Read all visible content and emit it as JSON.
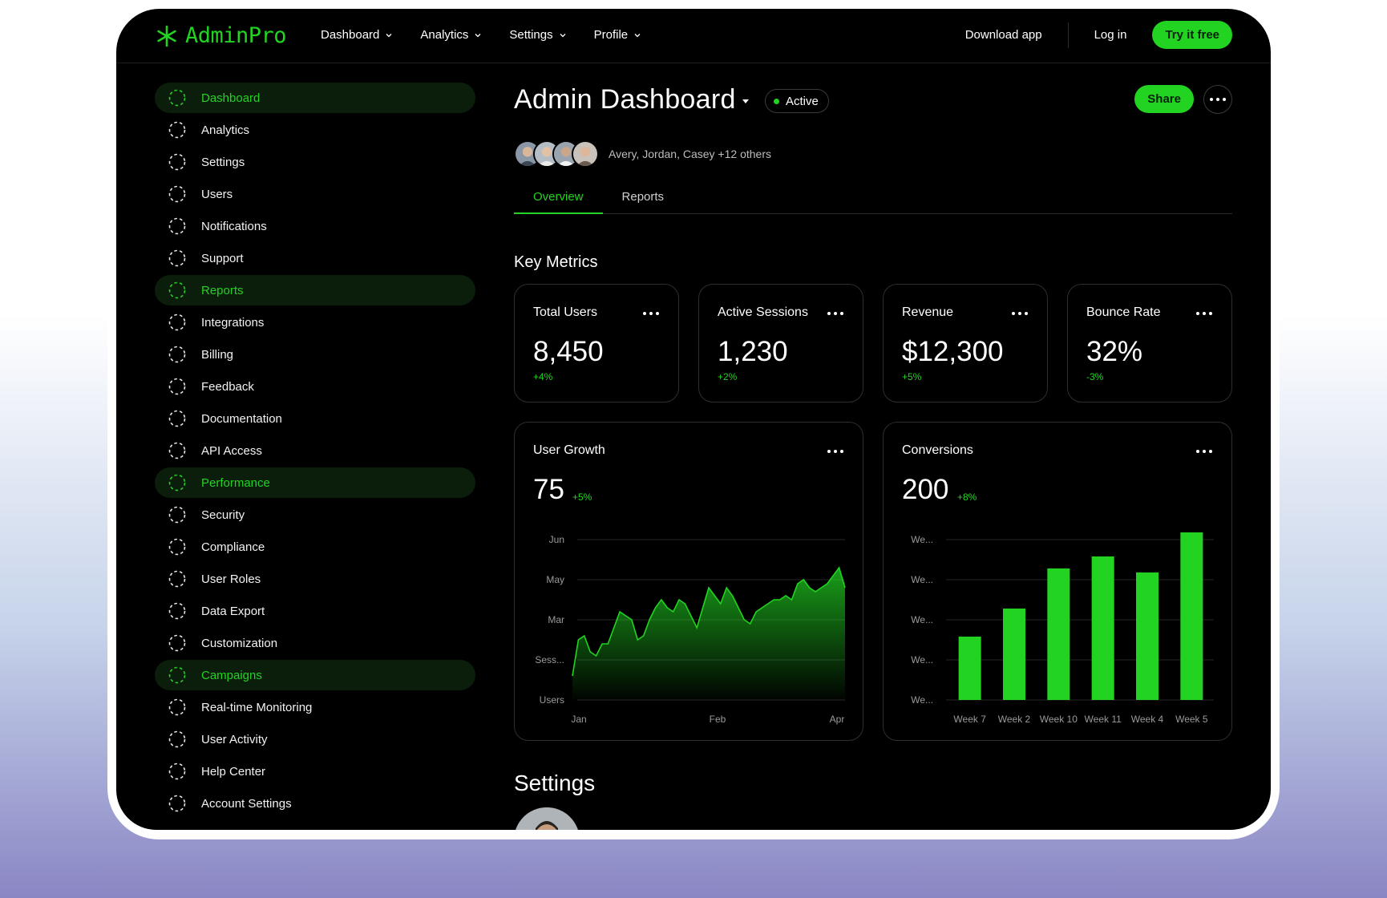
{
  "brand": {
    "name": "AdminPro",
    "color": "#22d322",
    "icon": "asterisk-icon"
  },
  "nav": {
    "menu": [
      {
        "label": "Dashboard"
      },
      {
        "label": "Analytics"
      },
      {
        "label": "Settings"
      },
      {
        "label": "Profile"
      }
    ],
    "download": "Download app",
    "login": "Log in",
    "try": "Try it free"
  },
  "sidebar": {
    "items": [
      {
        "label": "Dashboard",
        "active": true
      },
      {
        "label": "Analytics",
        "active": false
      },
      {
        "label": "Settings",
        "active": false
      },
      {
        "label": "Users",
        "active": false
      },
      {
        "label": "Notifications",
        "active": false
      },
      {
        "label": "Support",
        "active": false
      },
      {
        "label": "Reports",
        "active": true
      },
      {
        "label": "Integrations",
        "active": false
      },
      {
        "label": "Billing",
        "active": false
      },
      {
        "label": "Feedback",
        "active": false
      },
      {
        "label": "Documentation",
        "active": false
      },
      {
        "label": "API Access",
        "active": false
      },
      {
        "label": "Performance",
        "active": true
      },
      {
        "label": "Security",
        "active": false
      },
      {
        "label": "Compliance",
        "active": false
      },
      {
        "label": "User Roles",
        "active": false
      },
      {
        "label": "Data Export",
        "active": false
      },
      {
        "label": "Customization",
        "active": false
      },
      {
        "label": "Campaigns",
        "active": true
      },
      {
        "label": "Real-time Monitoring",
        "active": false
      },
      {
        "label": "User Activity",
        "active": false
      },
      {
        "label": "Help Center",
        "active": false
      },
      {
        "label": "Account Settings",
        "active": false
      }
    ]
  },
  "page": {
    "title": "Admin Dashboard",
    "status": "Active",
    "share": "Share",
    "collaborators": "Avery, Jordan, Casey +12 others",
    "tabs": [
      {
        "label": "Overview",
        "active": true
      },
      {
        "label": "Reports",
        "active": false
      }
    ],
    "key_metrics_title": "Key Metrics",
    "settings_title": "Settings"
  },
  "metrics": [
    {
      "label": "Total Users",
      "value": "8,450",
      "delta": "+4%"
    },
    {
      "label": "Active Sessions",
      "value": "1,230",
      "delta": "+2%"
    },
    {
      "label": "Revenue",
      "value": "$12,300",
      "delta": "+5%"
    },
    {
      "label": "Bounce Rate",
      "value": "32%",
      "delta": "-3%"
    }
  ],
  "user_growth": {
    "label": "User Growth",
    "value": "75",
    "delta": "+5%"
  },
  "conversions": {
    "label": "Conversions",
    "value": "200",
    "delta": "+8%"
  },
  "chart_data": [
    {
      "type": "area",
      "title": "User Growth",
      "x_ticks": [
        "Jan",
        "Feb",
        "Apr"
      ],
      "y_ticks": [
        "Users",
        "Sess...",
        "Mar",
        "May",
        "Jun"
      ],
      "ylim": [
        0,
        4
      ],
      "series": [
        {
          "values": [
            0.6,
            1.5,
            1.6,
            1.2,
            1.1,
            1.4,
            1.4,
            1.8,
            2.2,
            2.1,
            2.0,
            1.5,
            1.6,
            2.0,
            2.3,
            2.5,
            2.3,
            2.2,
            2.5,
            2.4,
            2.1,
            1.8,
            2.3,
            2.8,
            2.6,
            2.4,
            2.8,
            2.6,
            2.3,
            2.0,
            1.9,
            2.2,
            2.3,
            2.4,
            2.5,
            2.5,
            2.6,
            2.5,
            2.9,
            3.0,
            2.8,
            2.7,
            2.8,
            2.9,
            3.1,
            3.3,
            2.8
          ]
        }
      ]
    },
    {
      "type": "bar",
      "title": "Conversions",
      "categories": [
        "Week 7",
        "Week 2",
        "Week 10",
        "Week 11",
        "Week 4",
        "Week 5"
      ],
      "y_ticks": [
        "We...",
        "We...",
        "We...",
        "We...",
        "We..."
      ],
      "ylim": [
        0,
        4
      ],
      "values": [
        1.7,
        2.4,
        3.4,
        3.7,
        3.3,
        4.3
      ]
    }
  ]
}
